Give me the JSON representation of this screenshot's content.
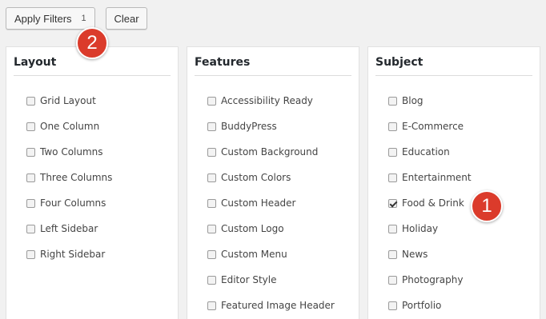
{
  "toolbar": {
    "apply_label": "Apply Filters",
    "apply_count": "1",
    "clear_label": "Clear"
  },
  "panels": {
    "layout": {
      "title": "Layout",
      "options": [
        "Grid Layout",
        "One Column",
        "Two Columns",
        "Three Columns",
        "Four Columns",
        "Left Sidebar",
        "Right Sidebar"
      ]
    },
    "features": {
      "title": "Features",
      "options": [
        "Accessibility Ready",
        "BuddyPress",
        "Custom Background",
        "Custom Colors",
        "Custom Header",
        "Custom Logo",
        "Custom Menu",
        "Editor Style",
        "Featured Image Header"
      ]
    },
    "subject": {
      "title": "Subject",
      "options": [
        "Blog",
        "E-Commerce",
        "Education",
        "Entertainment",
        "Food & Drink",
        "Holiday",
        "News",
        "Photography",
        "Portfolio"
      ],
      "checked": [
        "Food & Drink"
      ]
    }
  },
  "annotations": {
    "badge_1": "1",
    "badge_2": "2",
    "badge_color": "#db3b2b"
  }
}
